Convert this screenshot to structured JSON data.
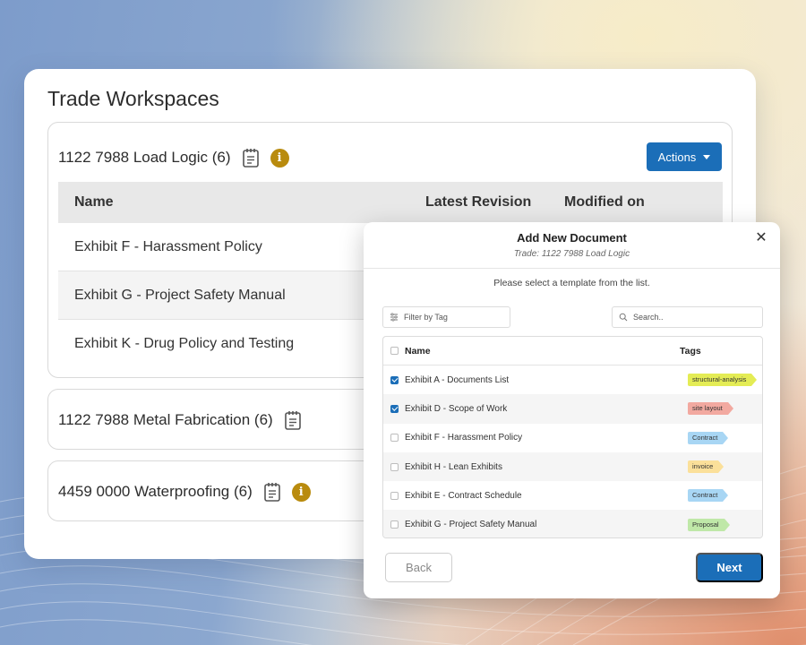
{
  "workspace": {
    "title": "Trade Workspaces",
    "trades": [
      {
        "name": "1122 7988 Load Logic (6)",
        "has_info": true,
        "actions_label": "Actions",
        "columns": [
          "Name",
          "Latest Revision",
          "Modified on"
        ],
        "documents": [
          "Exhibit F - Harassment Policy",
          "Exhibit G - Project Safety Manual",
          "Exhibit K - Drug Policy and Testing"
        ]
      },
      {
        "name": "1122 7988 Metal Fabrication (6)",
        "has_info": false
      },
      {
        "name": "4459 0000 Waterproofing (6)",
        "has_info": true
      }
    ]
  },
  "modal": {
    "title": "Add New Document",
    "subtitle": "Trade: 1122 7988 Load Logic",
    "hint": "Please select a template from the list.",
    "filter_placeholder": "Filter by Tag",
    "search_placeholder": "Search..",
    "columns": {
      "name": "Name",
      "tags": "Tags"
    },
    "templates": [
      {
        "name": "Exhibit A - Documents List",
        "checked": true,
        "tag": "structural-analysis",
        "tag_color": "#e4ec55"
      },
      {
        "name": "Exhibit D - Scope of Work",
        "checked": true,
        "tag": "site layout",
        "tag_color": "#f2a9a0"
      },
      {
        "name": "Exhibit F - Harassment Policy",
        "checked": false,
        "tag": "Contract",
        "tag_color": "#a8d6f4"
      },
      {
        "name": "Exhibit H - Lean Exhibits",
        "checked": false,
        "tag": "invoice",
        "tag_color": "#fbe09a"
      },
      {
        "name": "Exhibit E - Contract Schedule",
        "checked": false,
        "tag": "Contract",
        "tag_color": "#a8d6f4"
      },
      {
        "name": "Exhibit G - Project Safety Manual",
        "checked": false,
        "tag": "Proposal",
        "tag_color": "#bfe8a8"
      }
    ],
    "back_label": "Back",
    "next_label": "Next"
  },
  "colors": {
    "primary": "#1b6eb8",
    "info": "#b98b0e"
  }
}
